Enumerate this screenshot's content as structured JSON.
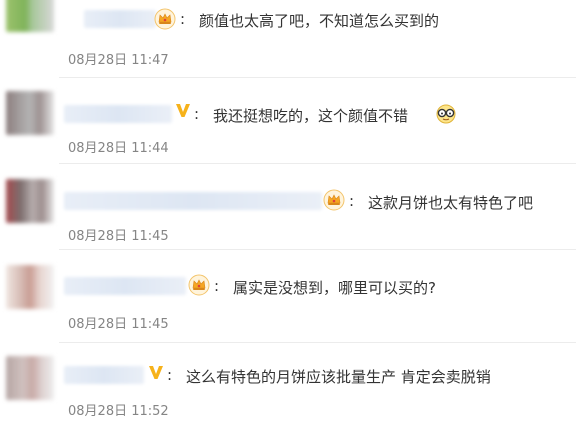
{
  "comments": [
    {
      "text": "颜值也太高了吧，不知道怎么买到的",
      "time": "08月28日 11:47",
      "colon": ":",
      "badge": "crown-icon"
    },
    {
      "text": "我还挺想吃的，这个颜值不错",
      "time": "08月28日 11:44",
      "colon": ":",
      "badge": "v-icon",
      "emoji": "glasses-emoji-icon"
    },
    {
      "text": "这款月饼也太有特色了吧",
      "time": "08月28日 11:45",
      "colon": ":",
      "badge": "crown-icon"
    },
    {
      "text": "属实是没想到，哪里可以买的?",
      "time": "08月28日 11:45",
      "colon": ":",
      "badge": "crown-icon"
    },
    {
      "text": "这么有特色的月饼应该批量生产 肯定会卖脱销",
      "time": "08月28日 11:52",
      "colon": ":",
      "badge": "v-icon"
    }
  ],
  "colors": {
    "text": "#333333",
    "timestamp": "#858585",
    "crown": "#f5a623",
    "crown_jewel": "#e0413a",
    "v_badge": "#f6b21b",
    "divider": "#ececec"
  }
}
